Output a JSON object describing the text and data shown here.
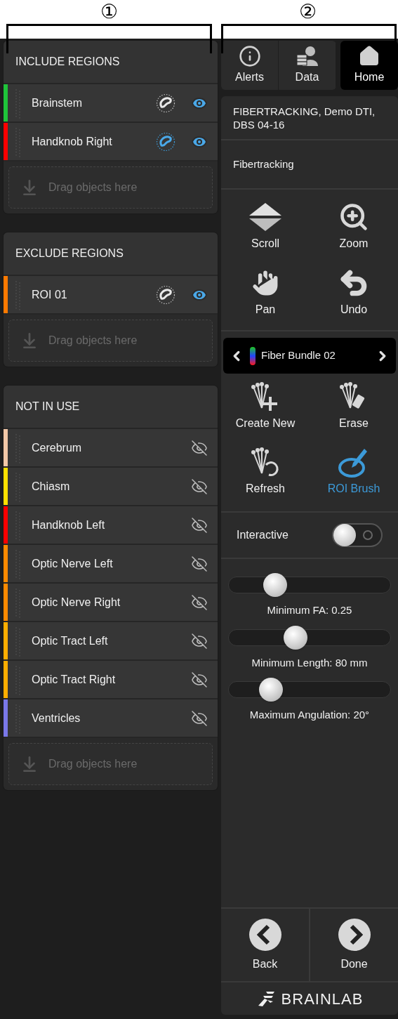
{
  "callouts": [
    {
      "label": "①"
    },
    {
      "label": "②"
    }
  ],
  "sections": [
    {
      "title": "INCLUDE REGIONS",
      "items": [
        {
          "name": "Brainstem",
          "color": "#1fc43a",
          "visible": true,
          "roi_selected": false
        },
        {
          "name": "Handknob Right",
          "color": "#ff0000",
          "visible": true,
          "roi_selected": true
        }
      ],
      "drop_hint": "Drag objects here"
    },
    {
      "title": "EXCLUDE REGIONS",
      "items": [
        {
          "name": "ROI 01",
          "color": "#ff7a00",
          "visible": true,
          "roi_selected": false
        }
      ],
      "drop_hint": "Drag objects here"
    },
    {
      "title": "NOT IN USE",
      "items": [
        {
          "name": "Cerebrum",
          "color": "#f2c8a8",
          "visible": false
        },
        {
          "name": "Chiasm",
          "color": "#ffe100",
          "visible": false
        },
        {
          "name": "Handknob Left",
          "color": "#ff0000",
          "visible": false
        },
        {
          "name": "Optic Nerve Left",
          "color": "#ff8a00",
          "visible": false
        },
        {
          "name": "Optic Nerve Right",
          "color": "#ff8a00",
          "visible": false
        },
        {
          "name": "Optic Tract Left",
          "color": "#ffae00",
          "visible": false
        },
        {
          "name": "Optic Tract Right",
          "color": "#ffae00",
          "visible": false
        },
        {
          "name": "Ventricles",
          "color": "#7a78e8",
          "visible": false
        }
      ],
      "drop_hint": "Drag objects here"
    }
  ],
  "tabs": [
    {
      "label": "Alerts",
      "selected": false
    },
    {
      "label": "Data",
      "selected": false
    },
    {
      "label": "Home",
      "selected": true
    }
  ],
  "title": "FIBERTRACKING, Demo DTI, DBS 04-16",
  "step": "Fibertracking",
  "view_tools": [
    {
      "label": "Scroll"
    },
    {
      "label": "Zoom"
    },
    {
      "label": "Pan"
    },
    {
      "label": "Undo"
    }
  ],
  "bundle": {
    "name": "Fiber Bundle 02"
  },
  "fiber_tools": [
    {
      "label": "Create New",
      "selected": false
    },
    {
      "label": "Erase",
      "selected": false
    },
    {
      "label": "Refresh",
      "selected": false
    },
    {
      "label": "ROI Brush",
      "selected": true
    }
  ],
  "interactive": {
    "label": "Interactive",
    "on": false
  },
  "sliders": [
    {
      "label": "Minimum FA: 0.25",
      "level": 0.25
    },
    {
      "label": "Minimum Length: 80 mm",
      "level": 0.4
    },
    {
      "label": "Maximum Angulation: 20°",
      "level": 0.22
    }
  ],
  "nav": [
    {
      "label": "Back"
    },
    {
      "label": "Done"
    }
  ],
  "brand": "BRAINLAB"
}
